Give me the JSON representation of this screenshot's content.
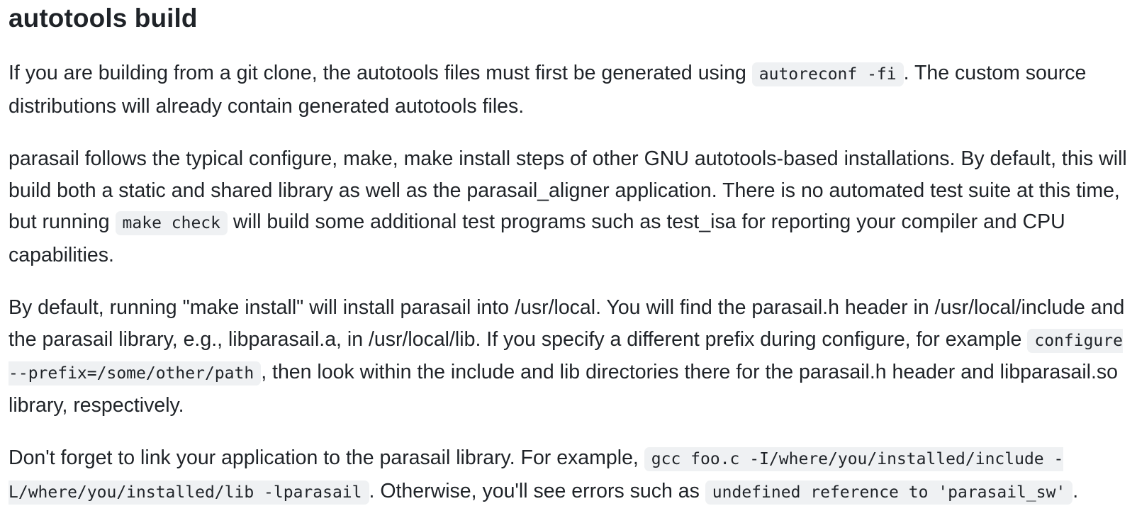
{
  "heading": "autotools build",
  "paragraphs": [
    {
      "t1": "If you are building from a git clone, the autotools files must first be generated using ",
      "c1": "autoreconf -fi",
      "t2": ". The custom source distributions will already contain generated autotools files."
    },
    {
      "t1": "parasail follows the typical configure, make, make install steps of other GNU autotools-based installations. By default, this will build both a static and shared library as well as the parasail_aligner application. There is no automated test suite at this time, but running ",
      "c1": "make check",
      "t2": " will build some additional test programs such as test_isa for reporting your compiler and CPU capabilities."
    },
    {
      "t1": "By default, running \"make install\" will install parasail into /usr/local. You will find the parasail.h header in /usr/local/include and the parasail library, e.g., libparasail.a, in /usr/local/lib. If you specify a different prefix during configure, for example ",
      "c1": "configure --prefix=/some/other/path",
      "t2": ", then look within the include and lib directories there for the parasail.h header and libparasail.so library, respectively."
    },
    {
      "t1": "Don't forget to link your application to the parasail library. For example, ",
      "c1": "gcc foo.c -I/where/you/installed/include -L/where/you/installed/lib -lparasail",
      "t2": ". Otherwise, you'll see errors such as ",
      "c2": "undefined reference to 'parasail_sw'",
      "t3": "."
    }
  ]
}
